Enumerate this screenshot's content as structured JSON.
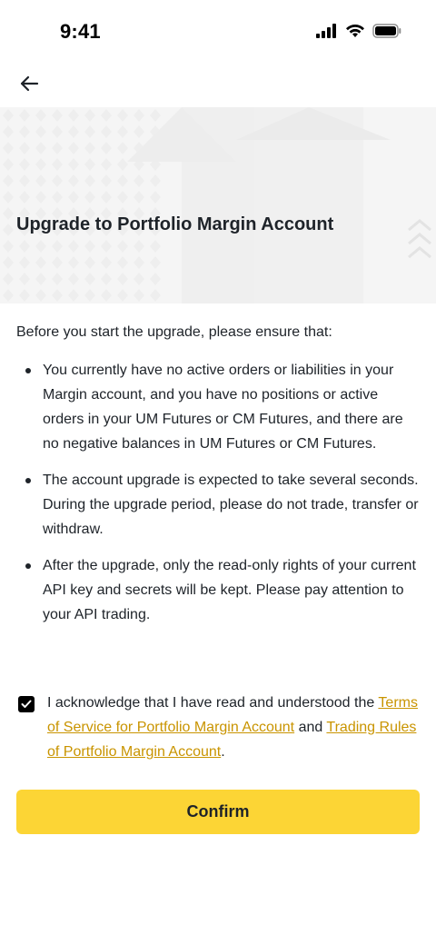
{
  "status_bar": {
    "time": "9:41",
    "icons": [
      "cellular-signal-icon",
      "wifi-icon",
      "battery-icon"
    ]
  },
  "nav": {
    "back_icon": "arrow-left-icon"
  },
  "hero": {
    "title": "Upgrade to Portfolio Margin Account"
  },
  "content": {
    "intro": "Before you start the upgrade, please ensure that:",
    "bullets": [
      "You currently have no active orders or liabilities in your Margin account, and you have no positions or active orders in your UM Futures or CM Futures, and there are no negative balances in UM Futures or CM Futures.",
      "The account upgrade is expected to take several seconds. During the upgrade period, please do not trade, transfer or withdraw.",
      "After the upgrade, only the read-only rights of your current API key and secrets will be kept. Please pay attention to your API trading."
    ]
  },
  "acknowledge": {
    "checked": true,
    "text_before": "I acknowledge that I have read and understood the ",
    "terms_link": "Terms of Service for Portfolio Margin Account",
    "text_middle": " and ",
    "rules_link": "Trading Rules of Portfolio Margin Account",
    "text_after": "."
  },
  "confirm_button": {
    "label": "Confirm"
  },
  "colors": {
    "accent": "#fcd535",
    "link": "#c99400",
    "text": "#1e2329",
    "hero_bg": "#f5f5f5"
  }
}
